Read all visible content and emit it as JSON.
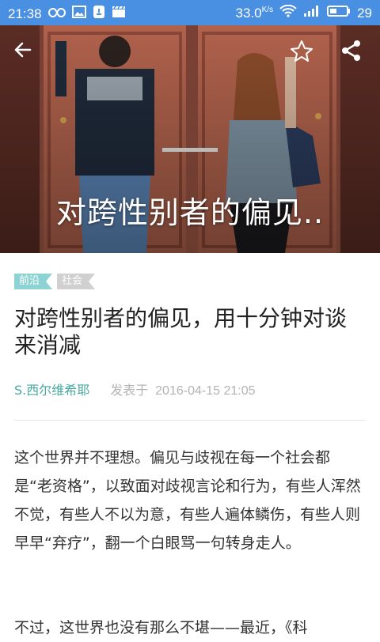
{
  "status_bar": {
    "time": "21:38",
    "speed": "33.0",
    "speed_unit": "K/s",
    "battery": "29",
    "icons_left": [
      "loop-icon",
      "image-icon",
      "bell-icon",
      "clapper-icon"
    ],
    "icons_right": [
      "wifi-icon",
      "signal-icon",
      "battery-icon"
    ]
  },
  "hero": {
    "title": "对跨性别者的偏见..",
    "icons": [
      "back-arrow-icon",
      "star-icon",
      "share-icon"
    ]
  },
  "tags": [
    "前沿",
    "社会"
  ],
  "article": {
    "title": "对跨性别者的偏见，用十分钟对谈来消减",
    "author": "S.西尔维希耶",
    "posted_label": "发表于",
    "date": "2016-04-15 21:05",
    "paragraphs": [
      "这个世界并不理想。偏见与歧视在每一个社会都是“老资格”，以致面对歧视言论和行为，有些人浑然不觉，有些人不以为意，有些人遍体鳞伤，有些人则早早“弃疗”，翻一个白眼骂一句转身走人。",
      "不过，这世界也没有那么不堪——最近，《科"
    ]
  },
  "colors": {
    "status_bar": "#4a90e2",
    "tag_primary": "#8dd3d3",
    "tag_secondary": "#d0d0d0",
    "author": "#4aa8a0"
  }
}
